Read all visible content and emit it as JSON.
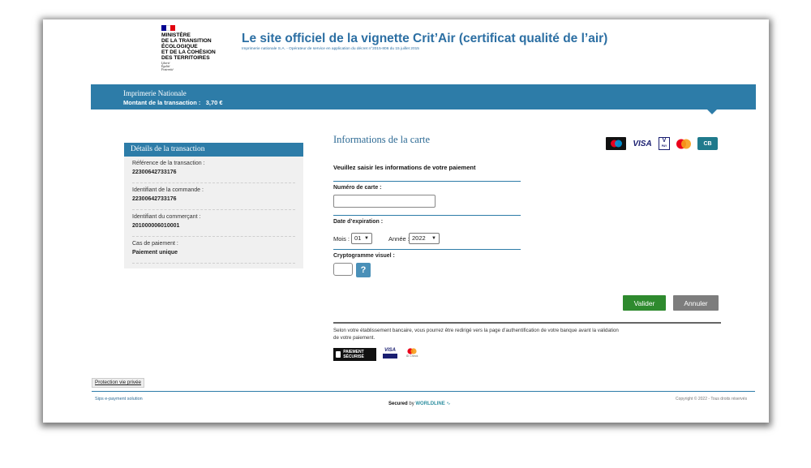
{
  "header": {
    "ministry_lines": "MINISTÈRE\nDE LA TRANSITION\nÉCOLOGIQUE\nET DE LA COHÉSION\nDES TERRITOIRES",
    "motto": "Liberté\nÉgalité\nFraternité",
    "title": "Le site officiel de la vignette Crit’Air (certificat qualité de l’air)",
    "subtitle": "Imprimerie nationale S.A. - Opérateur de service en application du décret n°2015-806 du 15 juillet 2015"
  },
  "band": {
    "merchant": "Imprimerie Nationale",
    "amount_label": "Montant de la transaction :",
    "amount_value": "3,70 €"
  },
  "details": {
    "title": "Détails de la transaction",
    "items": [
      {
        "label": "Référence de la transaction :",
        "value": "22300642733176"
      },
      {
        "label": "Identifiant de la commande :",
        "value": "22300642733176"
      },
      {
        "label": "Identifiant du commerçant :",
        "value": "201000006010001"
      },
      {
        "label": "Cas de paiement :",
        "value": "Paiement unique"
      }
    ]
  },
  "card": {
    "title": "Informations de la carte",
    "instruction": "Veuillez saisir les informations de votre paiement",
    "card_number_label": "Numéro de carte :",
    "card_number_value": "",
    "expiry_label": "Date d’expiration :",
    "month_label": "Mois :",
    "month_value": "01",
    "year_label": "Année :",
    "year_value": "2022",
    "cvv_label": "Cryptogramme visuel :",
    "cvv_value": "",
    "help_symbol": "?",
    "logos": {
      "visa": "VISA",
      "vpay_top": "V",
      "vpay_bottom": "PAY",
      "cb": "CB"
    }
  },
  "actions": {
    "submit": "Valider",
    "cancel": "Annuler"
  },
  "notice": {
    "text": "Selon votre établissement bancaire, vous pourrez être redirigé vers la page d’authentification de votre banque avant la validation de votre paiement.",
    "secure_badge": "PAIEMENT SÉCURISÉ",
    "visa_badge": "VISA",
    "mc_badge": "ID Check"
  },
  "footer": {
    "privacy": "Protection vie privée",
    "sips": "Sips e-payment solution",
    "secured_prefix": "Secured",
    "secured_by": "by",
    "worldline": "WORLDLINE",
    "copyright": "Copyright © 2022 - Tous droits réservés"
  },
  "colors": {
    "primary_blue": "#2d7ca8",
    "title_blue": "#2c6fa3",
    "submit_green": "#2e8a2e",
    "cancel_gray": "#7d7d7d"
  }
}
